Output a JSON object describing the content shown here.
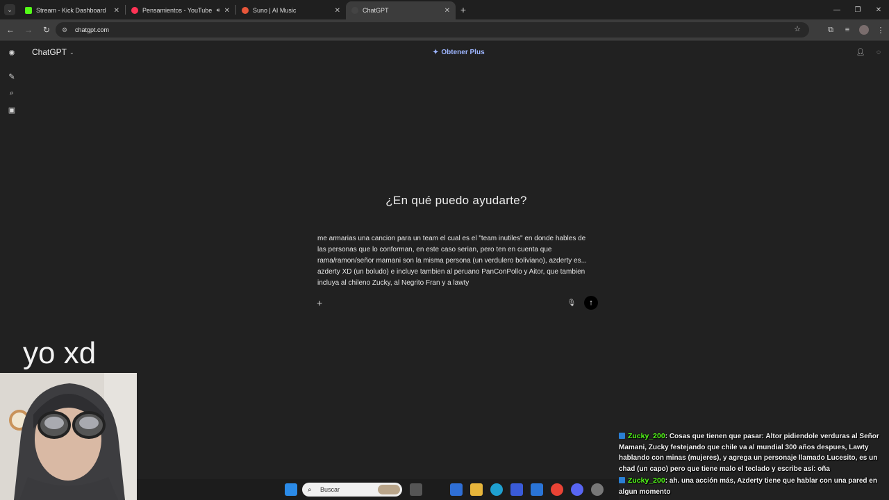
{
  "browser": {
    "tabs": [
      {
        "label": "Stream - Kick Dashboard",
        "favicon_color": "#53fc18",
        "active": false
      },
      {
        "label": "Pensamientos - YouTube M",
        "favicon_color": "#ff3355",
        "active": false,
        "sound_icon": "speaker-icon"
      },
      {
        "label": "Suno | AI Music",
        "favicon_color": "#e8563a",
        "active": false
      },
      {
        "label": "ChatGPT",
        "favicon_color": "#444444",
        "active": true
      }
    ],
    "new_tab_label": "+",
    "url": "chatgpt.com"
  },
  "app": {
    "model_selector": "ChatGPT",
    "upgrade_link": "Obtener Plus",
    "greeting": "¿En qué puedo ayudarte?",
    "prompt_text": "me armarias una cancion para un team el cual es el \"team inutiles\" en donde hables de las personas que lo conforman, en este caso serian, pero ten en cuenta que rama/ramon/señor mamani son la misma persona (un verdulero boliviano), azderty es... azderty XD (un boludo) e incluye tambien al peruano PanConPollo y Aitor, que tambien incluya al chileno Zucky, al Negrito Fran y a lawty"
  },
  "stream": {
    "overlay_caption": "yo xd",
    "chat": [
      {
        "user": "Zucky_200",
        "text": ": Cosas que tienen que pasar: Altor pidiendole verduras al Señor Mamani, Zucky festejando que chile va al mundial 300 años despues, Lawty hablando con minas (mujeres), y agrega un personaje llamado Lucesito, es un chad (un capo) pero que tiene malo el teclado y escribe así: oña"
      },
      {
        "user": "Zucky_200",
        "text": ": ah. una acción más, Azderty tiene que hablar con una pared en algun momento"
      }
    ]
  },
  "taskbar": {
    "search_placeholder": "Buscar"
  },
  "colors": {
    "accent_link": "#9db5ff",
    "kick_green": "#53fc18",
    "background": "#212121"
  }
}
